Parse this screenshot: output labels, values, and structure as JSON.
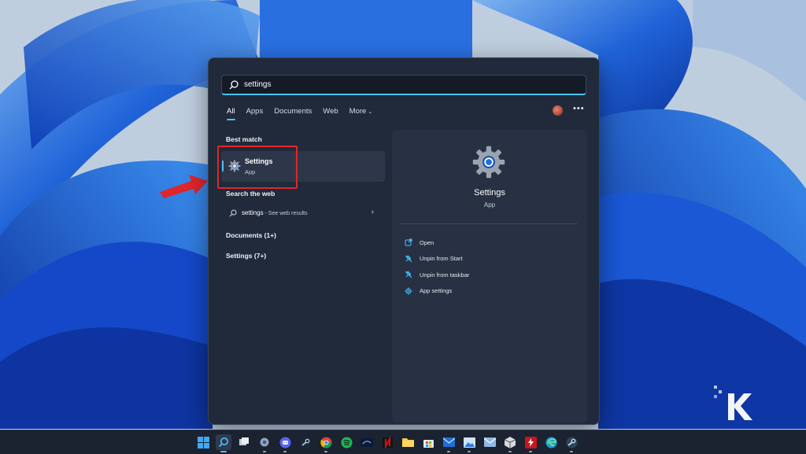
{
  "search": {
    "query": "settings"
  },
  "filters": [
    {
      "label": "All",
      "active": true
    },
    {
      "label": "Apps",
      "active": false
    },
    {
      "label": "Documents",
      "active": false
    },
    {
      "label": "Web",
      "active": false
    },
    {
      "label": "More",
      "active": false
    }
  ],
  "more_chevron": "⌄",
  "overflow_label": "•••",
  "best_match": {
    "title": "Best match",
    "item_name": "Settings",
    "item_type": "App",
    "icon": "gear-icon"
  },
  "search_web": {
    "title": "Search the web",
    "query": "settings",
    "suffix": " - See web results",
    "arrow": "›"
  },
  "groups": [
    {
      "label": "Documents (1+)"
    },
    {
      "label": "Settings (7+)"
    }
  ],
  "detail": {
    "name": "Settings",
    "type": "App",
    "actions": [
      {
        "label": "Open",
        "icon": "open-icon"
      },
      {
        "label": "Unpin from Start",
        "icon": "unpin-icon"
      },
      {
        "label": "Unpin from taskbar",
        "icon": "unpin-icon"
      },
      {
        "label": "App settings",
        "icon": "gear-icon"
      }
    ]
  },
  "taskbar": {
    "apps": [
      "start",
      "search",
      "task-view",
      "settings",
      "discord",
      "steam",
      "chrome",
      "spotify",
      "disney-plus",
      "netflix",
      "file-explorer",
      "microsoft-store",
      "mail",
      "photos",
      "mail-alt",
      "app-box",
      "antivirus",
      "edge",
      "steam-alt"
    ]
  },
  "colors": {
    "accent": "#4cc2ff",
    "panel_bg": "#202a3b",
    "highlight_box": "#e0262b",
    "arrow": "#e0262b"
  }
}
